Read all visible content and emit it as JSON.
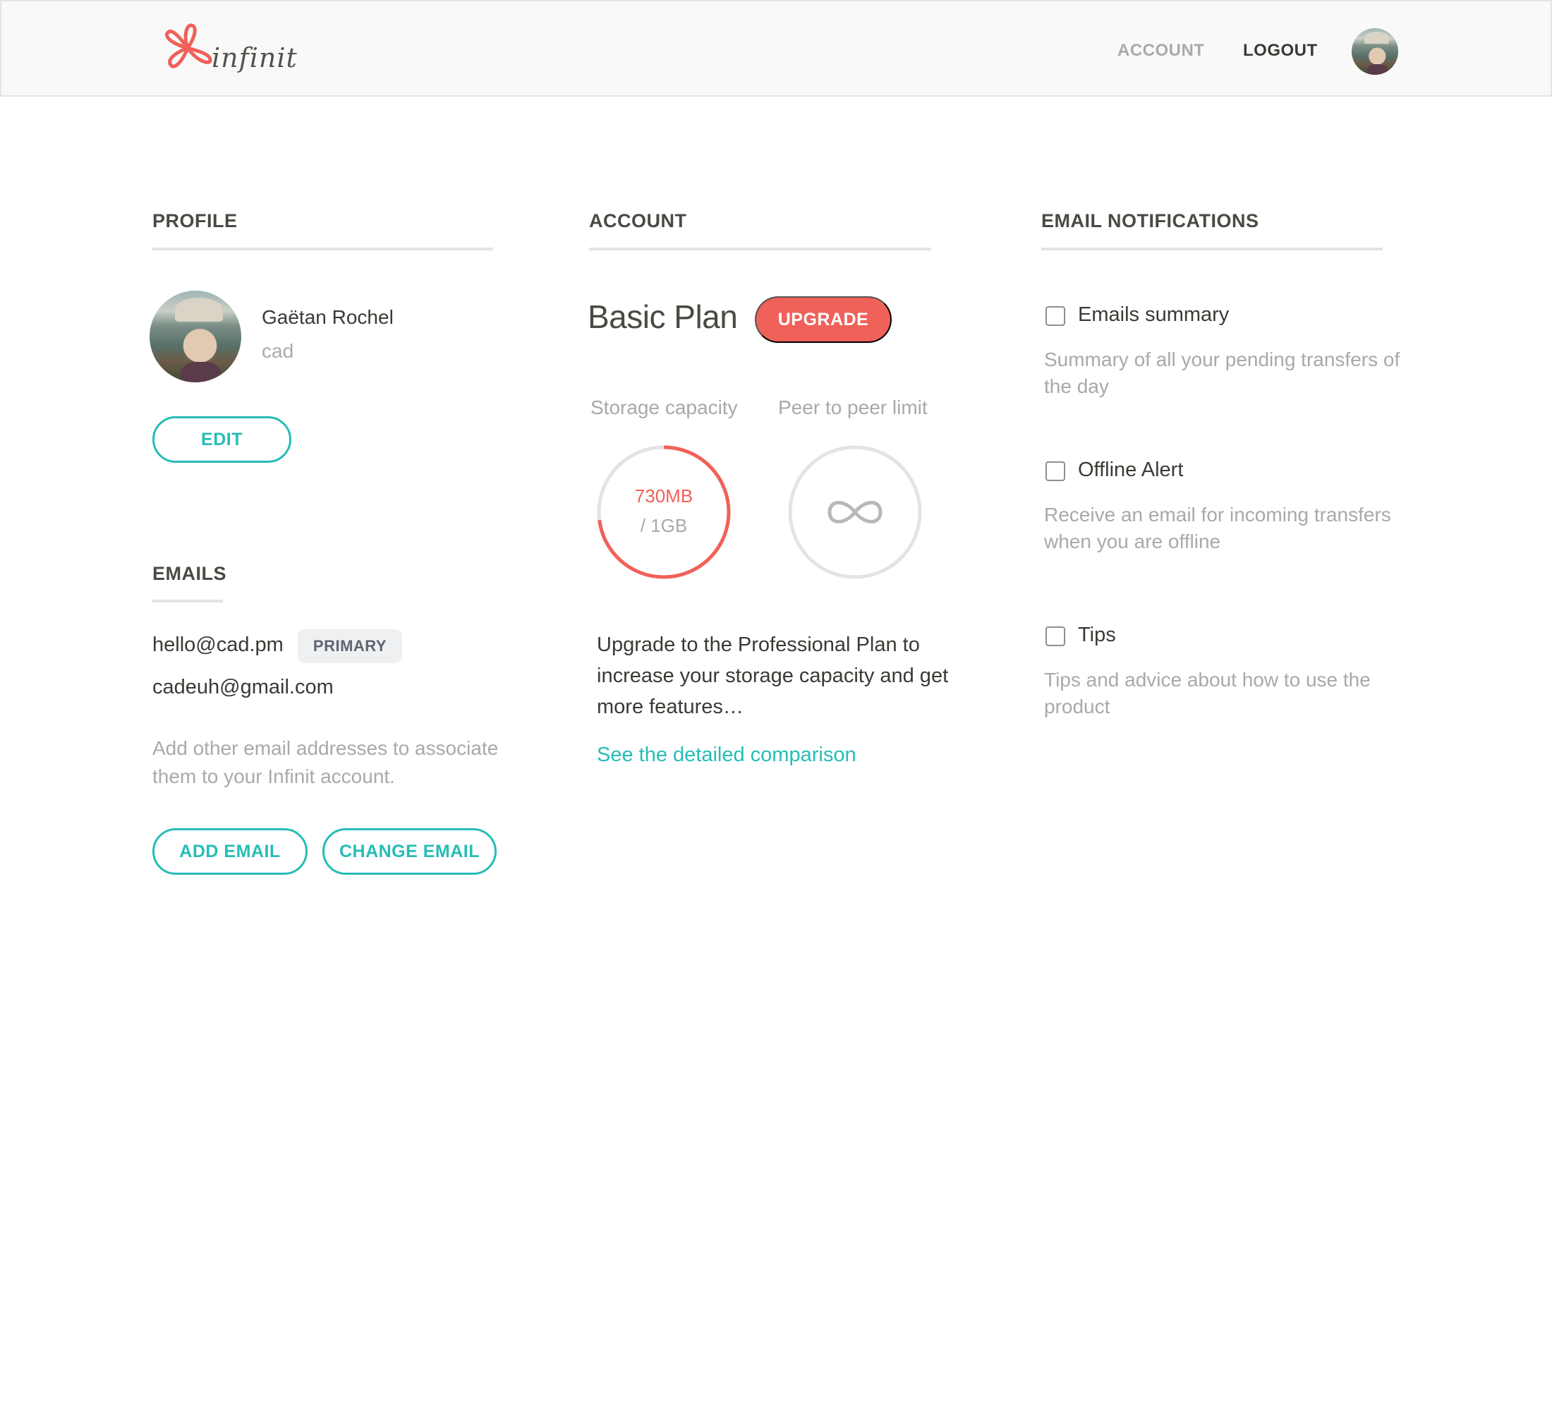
{
  "header": {
    "logo_text": "infinit",
    "nav": {
      "account": "ACCOUNT",
      "logout": "LOGOUT"
    }
  },
  "profile": {
    "title": "PROFILE",
    "name": "Gaëtan Rochel",
    "username": "cad",
    "edit_label": "EDIT"
  },
  "emails": {
    "title": "EMAILS",
    "items": [
      {
        "address": "hello@cad.pm",
        "badge": "PRIMARY"
      },
      {
        "address": "cadeuh@gmail.com"
      }
    ],
    "help": "Add other email addresses to associate them to your Infinit account.",
    "add_label": "ADD EMAIL",
    "change_label": "CHANGE EMAIL"
  },
  "account": {
    "title": "ACCOUNT",
    "plan": "Basic Plan",
    "upgrade_label": "UPGRADE",
    "storage": {
      "label": "Storage capacity",
      "used": "730MB",
      "total": "/ 1GB",
      "fraction": 0.73
    },
    "p2p": {
      "label": "Peer to peer limit",
      "value": "∞"
    },
    "upgrade_text": "Upgrade to the Professional Plan to increase your storage capacity and get more features…",
    "comparison_link": "See the detailed comparison"
  },
  "notifications": {
    "title": "EMAIL NOTIFICATIONS",
    "items": [
      {
        "label": "Emails summary",
        "description": "Summary of all your pending transfers of the day",
        "checked": false
      },
      {
        "label": "Offline Alert",
        "description": "Receive an email for incoming transfers when you are offline",
        "checked": false
      },
      {
        "label": "Tips",
        "description": "Tips and advice about how to use the product",
        "checked": false
      }
    ]
  },
  "colors": {
    "accent_teal": "#26bdb6",
    "accent_coral": "#f06159",
    "header_bg": "#f9f9f9",
    "muted_text": "#a9a9a9"
  },
  "icons": {
    "logo": "infinit-flower-logo-icon",
    "avatar": "user-avatar",
    "infinity": "infinity-icon",
    "checkbox": "checkbox-icon"
  }
}
